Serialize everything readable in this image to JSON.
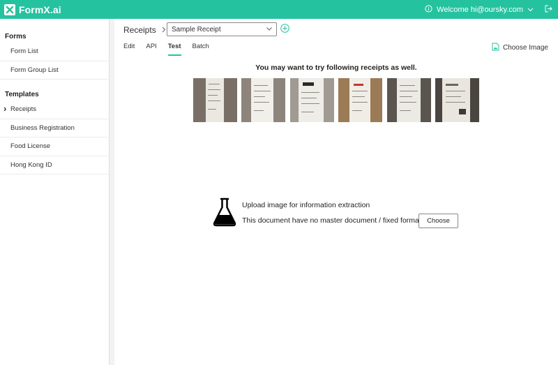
{
  "header": {
    "logo_text": "FormX.ai",
    "welcome": "Welcome hi@oursky.com",
    "brand_color": "#25c2a0",
    "icons": [
      "info-icon",
      "chevron-down-icon",
      "logout-icon"
    ]
  },
  "sidebar": {
    "forms_title": "Forms",
    "forms_items": [
      {
        "label": "Form List"
      },
      {
        "label": "Form Group List"
      }
    ],
    "templates_title": "Templates",
    "templates_items": [
      {
        "label": "Receipts",
        "active": true
      },
      {
        "label": "Business Registration"
      },
      {
        "label": "Food License"
      },
      {
        "label": "Hong Kong ID"
      }
    ]
  },
  "main": {
    "breadcrumb": "Receipts",
    "selected_template": "Sample Receipt",
    "tabs": [
      {
        "label": "Edit"
      },
      {
        "label": "API"
      },
      {
        "label": "Test",
        "active": true
      },
      {
        "label": "Batch"
      }
    ],
    "choose_image_label": "Choose Image",
    "suggest_title": "You may want to try following receipts as well.",
    "sample_receipts_count": 6,
    "upload_line1": "Upload image for information extraction",
    "upload_line2": "This document have no master document / fixed format",
    "choose_button": "Choose"
  }
}
